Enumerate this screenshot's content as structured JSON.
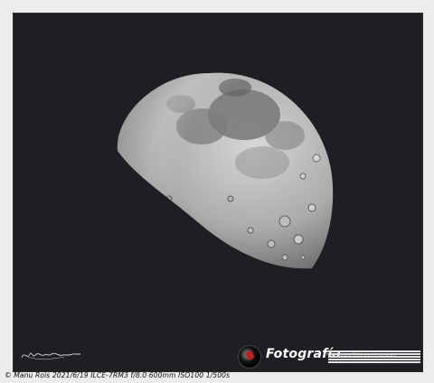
{
  "photo": {
    "subject_icon": "moon-icon",
    "background_color": "#1d1f22"
  },
  "watermark": {
    "brand_name": "Fotografía",
    "url": "http://www.flickr.com/manurois",
    "accent_color": "#c21d1d"
  },
  "caption": {
    "text": "© Manu Rois  2021/6/19  ILCE-7RM3  f/8.0  600mm  ISO100  1/500s"
  }
}
